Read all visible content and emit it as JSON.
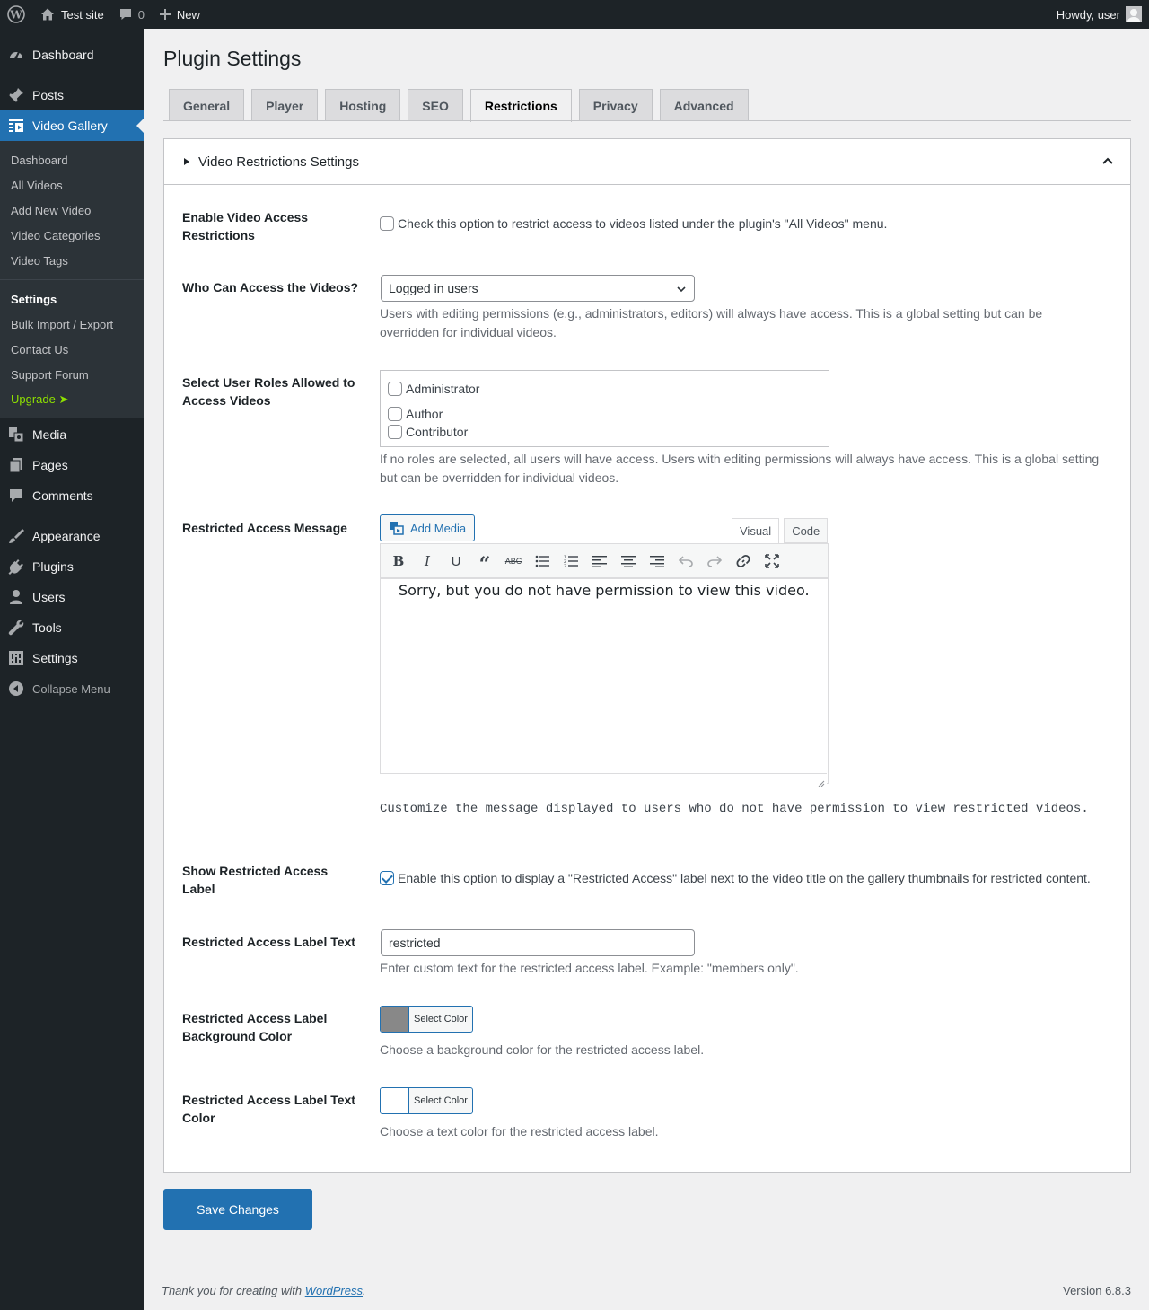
{
  "adminbar": {
    "site_name": "Test site",
    "comments_count": "0",
    "new_label": "New",
    "howdy": "Howdy, user"
  },
  "sidebar": {
    "top_items": [
      {
        "label": "Dashboard",
        "icon": "dashboard-icon"
      },
      {
        "label": "Posts",
        "icon": "pin-icon"
      },
      {
        "label": "Video Gallery",
        "icon": "video-gallery-icon"
      }
    ],
    "submenu": [
      "Dashboard",
      "All Videos",
      "Add New Video",
      "Video Categories",
      "Video Tags"
    ],
    "submenu2": [
      "Settings",
      "Bulk Import / Export",
      "Contact Us",
      "Support Forum",
      "Upgrade ➤"
    ],
    "bottom_items": [
      {
        "label": "Media",
        "icon": "media-icon"
      },
      {
        "label": "Pages",
        "icon": "pages-icon"
      },
      {
        "label": "Comments",
        "icon": "comments-icon"
      },
      {
        "label": "Appearance",
        "icon": "brush-icon"
      },
      {
        "label": "Plugins",
        "icon": "plugin-icon"
      },
      {
        "label": "Users",
        "icon": "users-icon"
      },
      {
        "label": "Tools",
        "icon": "wrench-icon"
      },
      {
        "label": "Settings",
        "icon": "settings-icon"
      }
    ],
    "collapse": "Collapse Menu"
  },
  "page": {
    "title": "Plugin Settings",
    "tabs": [
      "General",
      "Player",
      "Hosting",
      "SEO",
      "Restrictions",
      "Privacy",
      "Advanced"
    ],
    "active_tab": "Restrictions"
  },
  "panel": {
    "title": "Video Restrictions Settings",
    "enable": {
      "label": "Enable Video Access Restrictions",
      "checkbox_text": "Check this option to restrict access to videos listed under the plugin's \"All Videos\" menu.",
      "checked": false
    },
    "who": {
      "label": "Who Can Access the Videos?",
      "selected": "Logged in users",
      "desc": "Users with editing permissions (e.g., administrators, editors) will always have access. This is a global setting but can be overridden for individual videos."
    },
    "roles": {
      "label": "Select User Roles Allowed to Access Videos",
      "items": [
        "Administrator",
        "Author",
        "Contributor"
      ],
      "desc": "If no roles are selected, all users will have access. Users with editing permissions will always have access. This is a global setting but can be overridden for individual videos."
    },
    "message": {
      "label": "Restricted Access Message",
      "add_media": "Add Media",
      "tab_visual": "Visual",
      "tab_code": "Code",
      "content": "Sorry, but you do not have permission to view this video.",
      "desc": "Customize the message displayed to users who do not have permission to view restricted videos."
    },
    "show_label": {
      "label": "Show Restricted Access Label",
      "checkbox_text": "Enable this option to display a \"Restricted Access\" label next to the video title on the gallery thumbnails for restricted content.",
      "checked": true
    },
    "label_text": {
      "label": "Restricted Access Label Text",
      "value": "restricted",
      "desc": "Enter custom text for the restricted access label. Example: \"members only\"."
    },
    "bg_color": {
      "label": "Restricted Access Label Background Color",
      "button": "Select Color",
      "color": "#888888",
      "desc": "Choose a background color for the restricted access label."
    },
    "text_color": {
      "label": "Restricted Access Label Text Color",
      "button": "Select Color",
      "color": "#ffffff",
      "desc": "Choose a text color for the restricted access label."
    }
  },
  "save_label": "Save Changes",
  "footer": {
    "thanks_prefix": "Thank you for creating with ",
    "wordpress_link": "WordPress",
    "thanks_suffix": ".",
    "version": "Version 6.8.3"
  },
  "colors": {
    "accent": "#2271b1",
    "adminbar": "#1d2327",
    "upgrade": "#8ee000"
  }
}
